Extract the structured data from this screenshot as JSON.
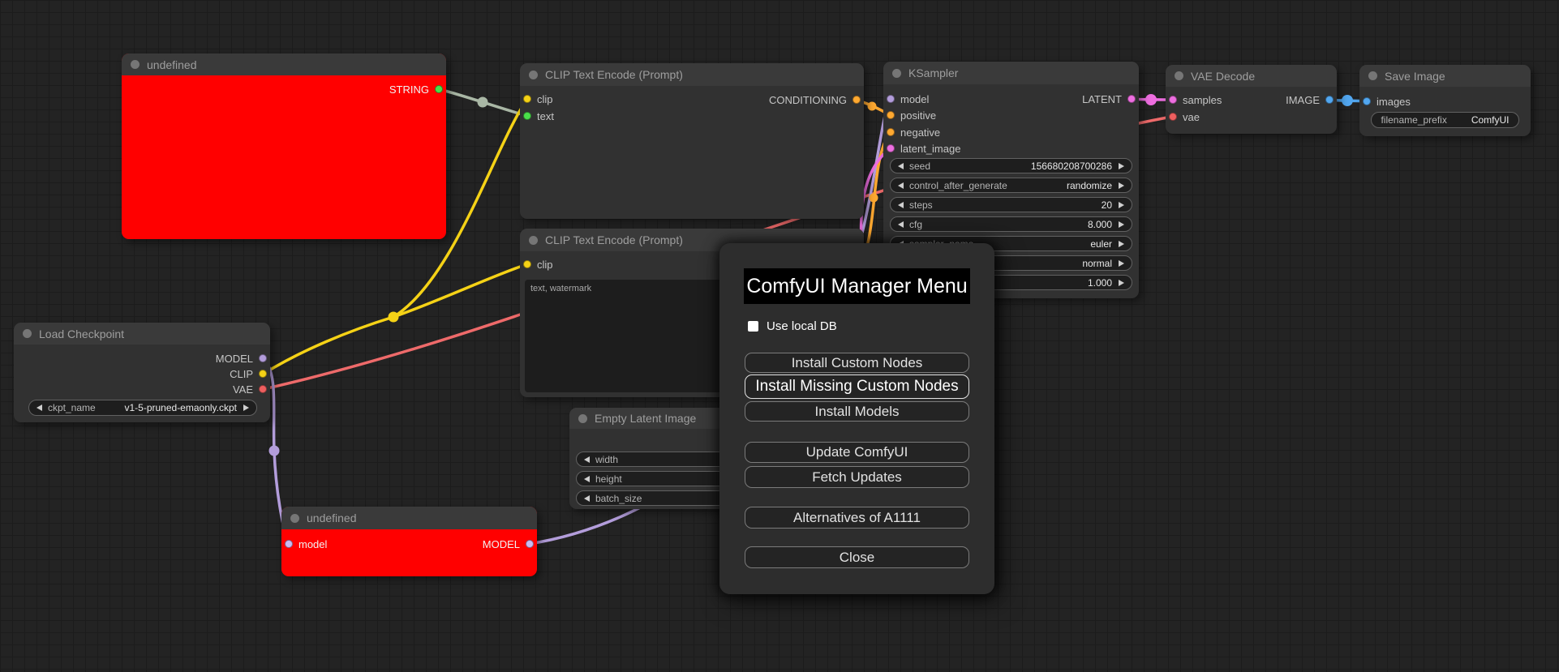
{
  "canvas": {
    "grid": "on"
  },
  "colors": {
    "clip": "#f5d216",
    "model": "#b39ddb",
    "vae": "#ee6a6a",
    "conditioning": "#ffa931",
    "latent": "#ee6ee0",
    "image": "#52a7f0",
    "string_wire": "#a9b7a5",
    "string_slot": "#4ade4a",
    "error_node": "#ff0000"
  },
  "nodes": {
    "undefined_top": {
      "title": "undefined",
      "outputs": [
        {
          "label": "STRING"
        }
      ]
    },
    "clip_encode_pos": {
      "title": "CLIP Text Encode (Prompt)",
      "inputs": [
        {
          "label": "clip"
        },
        {
          "label": "text"
        }
      ],
      "outputs": [
        {
          "label": "CONDITIONING"
        }
      ]
    },
    "clip_encode_neg": {
      "title": "CLIP Text Encode (Prompt)",
      "inputs": [
        {
          "label": "clip"
        }
      ],
      "text_value": "text, watermark"
    },
    "empty_latent": {
      "title": "Empty Latent Image",
      "widgets": [
        {
          "label": "width",
          "value": ""
        },
        {
          "label": "height",
          "value": ""
        },
        {
          "label": "batch_size",
          "value": ""
        }
      ]
    },
    "ksampler": {
      "title": "KSampler",
      "inputs": [
        {
          "label": "model"
        },
        {
          "label": "positive"
        },
        {
          "label": "negative"
        },
        {
          "label": "latent_image"
        }
      ],
      "outputs": [
        {
          "label": "LATENT"
        }
      ],
      "widgets": [
        {
          "label": "seed",
          "value": "156680208700286"
        },
        {
          "label": "control_after_generate",
          "value": "randomize"
        },
        {
          "label": "steps",
          "value": "20"
        },
        {
          "label": "cfg",
          "value": "8.000"
        },
        {
          "label": "sampler_name",
          "value": "euler"
        },
        {
          "label": "",
          "value": "normal"
        },
        {
          "label": "",
          "value": "1.000"
        }
      ]
    },
    "vae_decode": {
      "title": "VAE Decode",
      "inputs": [
        {
          "label": "samples"
        },
        {
          "label": "vae"
        }
      ],
      "outputs": [
        {
          "label": "IMAGE"
        }
      ]
    },
    "save_image": {
      "title": "Save Image",
      "inputs": [
        {
          "label": "images"
        }
      ],
      "widgets": [
        {
          "label": "filename_prefix",
          "value": "ComfyUI"
        }
      ]
    },
    "undefined_bottom": {
      "title": "undefined",
      "inputs": [
        {
          "label": "model"
        }
      ],
      "outputs": [
        {
          "label": "MODEL"
        }
      ]
    },
    "load_checkpoint": {
      "title": "Load Checkpoint",
      "outputs": [
        {
          "label": "MODEL"
        },
        {
          "label": "CLIP"
        },
        {
          "label": "VAE"
        }
      ],
      "widgets": [
        {
          "label": "ckpt_name",
          "value": "v1-5-pruned-emaonly.ckpt"
        }
      ]
    }
  },
  "dialog": {
    "title": "ComfyUI Manager Menu",
    "checkbox": {
      "label": "Use local DB",
      "checked": false
    },
    "buttons": [
      {
        "label": "Install Custom Nodes"
      },
      {
        "label": "Install Missing Custom Nodes"
      },
      {
        "label": "Install Models"
      },
      {
        "label": "Update ComfyUI"
      },
      {
        "label": "Fetch Updates"
      },
      {
        "label": "Alternatives of A1111"
      },
      {
        "label": "Close"
      }
    ]
  }
}
